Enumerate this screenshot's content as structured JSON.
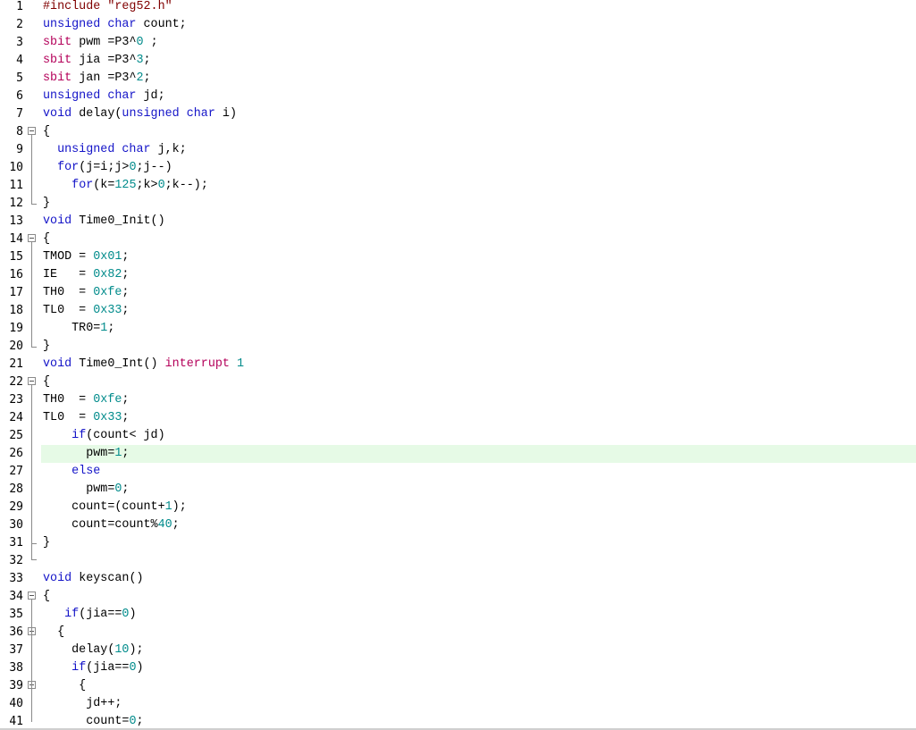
{
  "editor": {
    "language": "C (Keil 8051)",
    "highlight_color": "#e6fae6",
    "keyword_color": "#1414c8",
    "number_color": "#008b8b",
    "preprocessor_color": "#800000",
    "special_keyword_color": "#b4005a",
    "highlighted_line": 26,
    "lines": [
      {
        "n": "1",
        "tokens": [
          {
            "t": "#include \"reg52.h\"",
            "c": "pp"
          }
        ]
      },
      {
        "n": "2",
        "tokens": [
          {
            "t": "unsigned char",
            "c": "kw"
          },
          {
            "t": " count;",
            "c": "id"
          }
        ]
      },
      {
        "n": "3",
        "tokens": [
          {
            "t": "sbit",
            "c": "sb"
          },
          {
            "t": " pwm =P3^",
            "c": "id"
          },
          {
            "t": "0",
            "c": "num"
          },
          {
            "t": " ;",
            "c": "id"
          }
        ]
      },
      {
        "n": "4",
        "tokens": [
          {
            "t": "sbit",
            "c": "sb"
          },
          {
            "t": " jia =P3^",
            "c": "id"
          },
          {
            "t": "3",
            "c": "num"
          },
          {
            "t": ";",
            "c": "id"
          }
        ]
      },
      {
        "n": "5",
        "tokens": [
          {
            "t": "sbit",
            "c": "sb"
          },
          {
            "t": " jan =P3^",
            "c": "id"
          },
          {
            "t": "2",
            "c": "num"
          },
          {
            "t": ";",
            "c": "id"
          }
        ]
      },
      {
        "n": "6",
        "tokens": [
          {
            "t": "unsigned char",
            "c": "kw"
          },
          {
            "t": " jd;",
            "c": "id"
          }
        ]
      },
      {
        "n": "7",
        "tokens": [
          {
            "t": "void",
            "c": "kw"
          },
          {
            "t": " delay(",
            "c": "id"
          },
          {
            "t": "unsigned char",
            "c": "kw"
          },
          {
            "t": " i)",
            "c": "id"
          }
        ]
      },
      {
        "n": "8",
        "tokens": [
          {
            "t": "{",
            "c": "id"
          }
        ]
      },
      {
        "n": "9",
        "tokens": [
          {
            "t": "  ",
            "c": "id"
          },
          {
            "t": "unsigned char",
            "c": "kw"
          },
          {
            "t": " j,k;",
            "c": "id"
          }
        ]
      },
      {
        "n": "10",
        "tokens": [
          {
            "t": "  ",
            "c": "id"
          },
          {
            "t": "for",
            "c": "kw"
          },
          {
            "t": "(j=i;j>",
            "c": "id"
          },
          {
            "t": "0",
            "c": "num"
          },
          {
            "t": ";j--)",
            "c": "id"
          }
        ]
      },
      {
        "n": "11",
        "tokens": [
          {
            "t": "    ",
            "c": "id"
          },
          {
            "t": "for",
            "c": "kw"
          },
          {
            "t": "(k=",
            "c": "id"
          },
          {
            "t": "125",
            "c": "num"
          },
          {
            "t": ";k>",
            "c": "id"
          },
          {
            "t": "0",
            "c": "num"
          },
          {
            "t": ";k--);",
            "c": "id"
          }
        ]
      },
      {
        "n": "12",
        "tokens": [
          {
            "t": "}",
            "c": "id"
          }
        ]
      },
      {
        "n": "13",
        "tokens": [
          {
            "t": "void",
            "c": "kw"
          },
          {
            "t": " Time0_Init()",
            "c": "id"
          }
        ]
      },
      {
        "n": "14",
        "tokens": [
          {
            "t": "{",
            "c": "id"
          }
        ]
      },
      {
        "n": "15",
        "tokens": [
          {
            "t": "TMOD = ",
            "c": "id"
          },
          {
            "t": "0x01",
            "c": "num"
          },
          {
            "t": ";",
            "c": "id"
          }
        ]
      },
      {
        "n": "16",
        "tokens": [
          {
            "t": "IE   = ",
            "c": "id"
          },
          {
            "t": "0x82",
            "c": "num"
          },
          {
            "t": ";",
            "c": "id"
          }
        ]
      },
      {
        "n": "17",
        "tokens": [
          {
            "t": "TH0  = ",
            "c": "id"
          },
          {
            "t": "0xfe",
            "c": "num"
          },
          {
            "t": ";",
            "c": "id"
          }
        ]
      },
      {
        "n": "18",
        "tokens": [
          {
            "t": "TL0  = ",
            "c": "id"
          },
          {
            "t": "0x33",
            "c": "num"
          },
          {
            "t": ";",
            "c": "id"
          }
        ]
      },
      {
        "n": "19",
        "tokens": [
          {
            "t": "    TR0=",
            "c": "id"
          },
          {
            "t": "1",
            "c": "num"
          },
          {
            "t": ";",
            "c": "id"
          }
        ]
      },
      {
        "n": "20",
        "tokens": [
          {
            "t": "}",
            "c": "id"
          }
        ]
      },
      {
        "n": "21",
        "tokens": [
          {
            "t": "void",
            "c": "kw"
          },
          {
            "t": " Time0_Int() ",
            "c": "id"
          },
          {
            "t": "interrupt",
            "c": "sb"
          },
          {
            "t": " ",
            "c": "id"
          },
          {
            "t": "1",
            "c": "num"
          }
        ]
      },
      {
        "n": "22",
        "tokens": [
          {
            "t": "{",
            "c": "id"
          }
        ]
      },
      {
        "n": "23",
        "tokens": [
          {
            "t": "TH0  = ",
            "c": "id"
          },
          {
            "t": "0xfe",
            "c": "num"
          },
          {
            "t": ";",
            "c": "id"
          }
        ]
      },
      {
        "n": "24",
        "tokens": [
          {
            "t": "TL0  = ",
            "c": "id"
          },
          {
            "t": "0x33",
            "c": "num"
          },
          {
            "t": ";",
            "c": "id"
          }
        ]
      },
      {
        "n": "25",
        "tokens": [
          {
            "t": "    ",
            "c": "id"
          },
          {
            "t": "if",
            "c": "kw"
          },
          {
            "t": "(count< jd)",
            "c": "id"
          }
        ]
      },
      {
        "n": "26",
        "tokens": [
          {
            "t": "      pwm=",
            "c": "id"
          },
          {
            "t": "1",
            "c": "num"
          },
          {
            "t": ";",
            "c": "id"
          }
        ]
      },
      {
        "n": "27",
        "tokens": [
          {
            "t": "    ",
            "c": "id"
          },
          {
            "t": "else",
            "c": "kw"
          }
        ]
      },
      {
        "n": "28",
        "tokens": [
          {
            "t": "      pwm=",
            "c": "id"
          },
          {
            "t": "0",
            "c": "num"
          },
          {
            "t": ";",
            "c": "id"
          }
        ]
      },
      {
        "n": "29",
        "tokens": [
          {
            "t": "    count=(count+",
            "c": "id"
          },
          {
            "t": "1",
            "c": "num"
          },
          {
            "t": ");",
            "c": "id"
          }
        ]
      },
      {
        "n": "30",
        "tokens": [
          {
            "t": "    count=count%",
            "c": "id"
          },
          {
            "t": "40",
            "c": "num"
          },
          {
            "t": ";",
            "c": "id"
          }
        ]
      },
      {
        "n": "31",
        "tokens": [
          {
            "t": "}",
            "c": "id"
          }
        ]
      },
      {
        "n": "32",
        "tokens": []
      },
      {
        "n": "33",
        "tokens": [
          {
            "t": "void",
            "c": "kw"
          },
          {
            "t": " keyscan()",
            "c": "id"
          }
        ]
      },
      {
        "n": "34",
        "tokens": [
          {
            "t": "{",
            "c": "id"
          }
        ]
      },
      {
        "n": "35",
        "tokens": [
          {
            "t": "   ",
            "c": "id"
          },
          {
            "t": "if",
            "c": "kw"
          },
          {
            "t": "(jia==",
            "c": "id"
          },
          {
            "t": "0",
            "c": "num"
          },
          {
            "t": ")",
            "c": "id"
          }
        ]
      },
      {
        "n": "36",
        "tokens": [
          {
            "t": "  {",
            "c": "id"
          }
        ]
      },
      {
        "n": "37",
        "tokens": [
          {
            "t": "    delay(",
            "c": "id"
          },
          {
            "t": "10",
            "c": "num"
          },
          {
            "t": ");",
            "c": "id"
          }
        ]
      },
      {
        "n": "38",
        "tokens": [
          {
            "t": "    ",
            "c": "id"
          },
          {
            "t": "if",
            "c": "kw"
          },
          {
            "t": "(jia==",
            "c": "id"
          },
          {
            "t": "0",
            "c": "num"
          },
          {
            "t": ")",
            "c": "id"
          }
        ]
      },
      {
        "n": "39",
        "tokens": [
          {
            "t": "     {",
            "c": "id"
          }
        ]
      },
      {
        "n": "40",
        "tokens": [
          {
            "t": "      jd++;",
            "c": "id"
          }
        ]
      },
      {
        "n": "41",
        "tokens": [
          {
            "t": "      count=",
            "c": "id"
          },
          {
            "t": "0",
            "c": "num"
          },
          {
            "t": ";",
            "c": "id"
          }
        ]
      }
    ]
  }
}
